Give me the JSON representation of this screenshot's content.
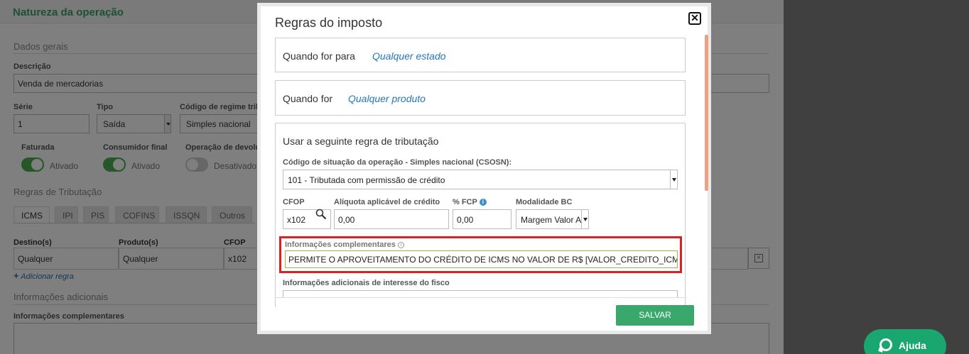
{
  "background": {
    "page_title": "Natureza da operação",
    "section_general": "Dados gerais",
    "description_label": "Descrição",
    "description_value": "Venda de mercadorias",
    "serie_label": "Série",
    "serie_value": "1",
    "tipo_label": "Tipo",
    "tipo_value": "Saída",
    "regime_label": "Código de regime trib",
    "regime_value": "Simples nacional",
    "faturada_label": "Faturada",
    "consumidor_label": "Consumidor final",
    "devolucao_label": "Operação de devolu",
    "ativado_text": "Ativado",
    "desativado_text": "Desativado",
    "section_rules": "Regras de Tributação",
    "tabs": [
      "ICMS",
      "IPI",
      "PIS",
      "COFINS",
      "ISSQN",
      "Outros"
    ],
    "table_headers": [
      "Destino(s)",
      "Produto(s)",
      "CFOP"
    ],
    "table_row": [
      "Qualquer",
      "Qualquer",
      "x102"
    ],
    "add_rule": "Adicionar regra",
    "section_info": "Informações adicionais",
    "info_label": "Informações complementares"
  },
  "modal": {
    "title": "Regras do imposto",
    "close_glyph": "✕",
    "when_state_label": "Quando for para",
    "when_state_link": "Qualquer estado",
    "when_product_label": "Quando for",
    "when_product_link": "Qualquer produto",
    "rule_heading": "Usar a seguinte regra de tributação",
    "csosn_label": "Código de situação da operação - Simples nacional (CSOSN):",
    "csosn_value": "101 - Tributada com permissão de crédito",
    "cfop_label": "CFOP",
    "cfop_value": "x102",
    "aliquota_label": "Alíquota aplicável de crédito",
    "aliquota_value": "0,00",
    "fcp_label": "% FCP",
    "fcp_value": "0,00",
    "modalidade_label": "Modalidade BC",
    "modalidade_value": "Margem Valor A",
    "info_comp_label": "Informações complementares",
    "info_comp_value": "PERMITE O APROVEITAMENTO DO CRÉDITO DE ICMS NO VALOR DE R$ [VALOR_CREDITO_ICMS]",
    "info_fisco_label": "Informações adicionais de interesse do fisco",
    "save_label": "SALVAR"
  },
  "help": {
    "label": "Ajuda"
  },
  "colors": {
    "accent_green": "#3aa86c",
    "link_blue": "#2577b8",
    "highlight_red": "#e0201f"
  }
}
